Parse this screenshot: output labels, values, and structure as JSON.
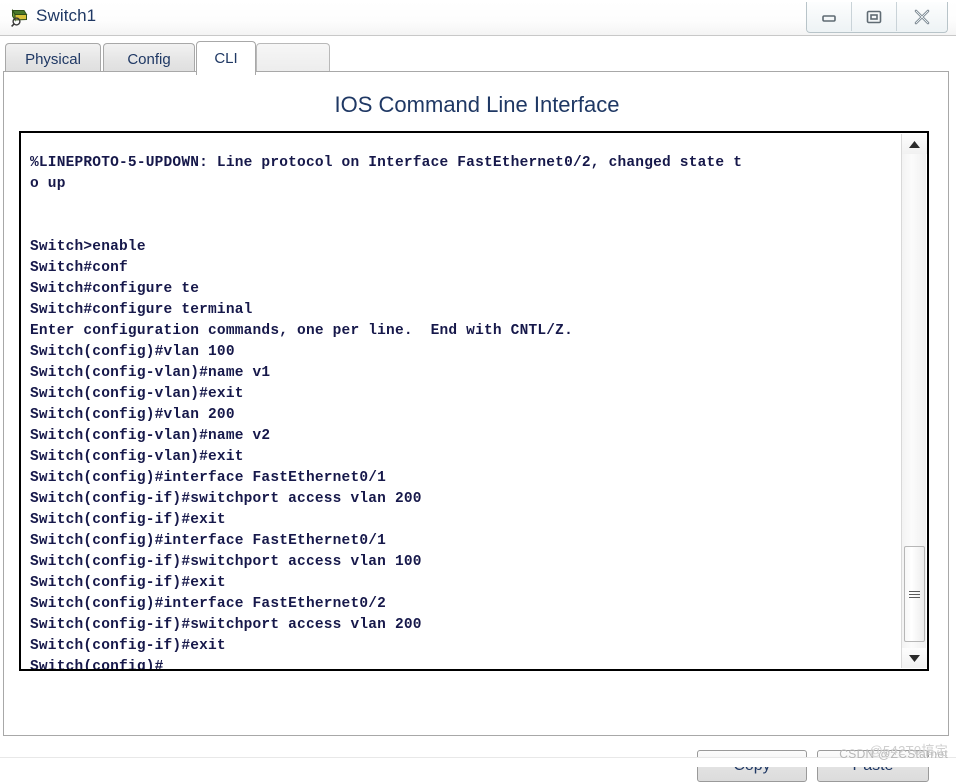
{
  "window": {
    "title": "Switch1",
    "icon": "switch-magnifier-icon",
    "controls": {
      "minimize_label": "Minimize",
      "maximize_label": "Maximize",
      "close_label": "Close"
    }
  },
  "tabs": [
    {
      "id": "physical",
      "label": "Physical",
      "active": false
    },
    {
      "id": "config",
      "label": "Config",
      "active": false
    },
    {
      "id": "cli",
      "label": "CLI",
      "active": true
    }
  ],
  "panel": {
    "title": "IOS Command Line Interface"
  },
  "terminal": {
    "lines": [
      "%LINEPROTO-5-UPDOWN: Line protocol on Interface FastEthernet0/2, changed state t",
      "o up",
      "",
      "",
      "Switch>enable",
      "Switch#conf",
      "Switch#configure te",
      "Switch#configure terminal",
      "Enter configuration commands, one per line.  End with CNTL/Z.",
      "Switch(config)#vlan 100",
      "Switch(config-vlan)#name v1",
      "Switch(config-vlan)#exit",
      "Switch(config)#vlan 200",
      "Switch(config-vlan)#name v2",
      "Switch(config-vlan)#exit",
      "Switch(config)#interface FastEthernet0/1",
      "Switch(config-if)#switchport access vlan 200",
      "Switch(config-if)#exit",
      "Switch(config)#interface FastEthernet0/1",
      "Switch(config-if)#switchport access vlan 100",
      "Switch(config-if)#exit",
      "Switch(config)#interface FastEthernet0/2",
      "Switch(config-if)#switchport access vlan 200",
      "Switch(config-if)#exit",
      "Switch(config)#"
    ],
    "text_color": "#16184a",
    "background": "#ffffff",
    "scrollbar": {
      "up_arrow": "scroll-up-arrow-icon",
      "down_arrow": "scroll-down-arrow-icon",
      "thumb_position_percent": 82
    }
  },
  "buttons": {
    "copy_label": "Copy",
    "paste_label": "Paste"
  },
  "watermark": {
    "primary": "CSDN @ZCStarnet",
    "secondary": "@542T0搞定"
  }
}
